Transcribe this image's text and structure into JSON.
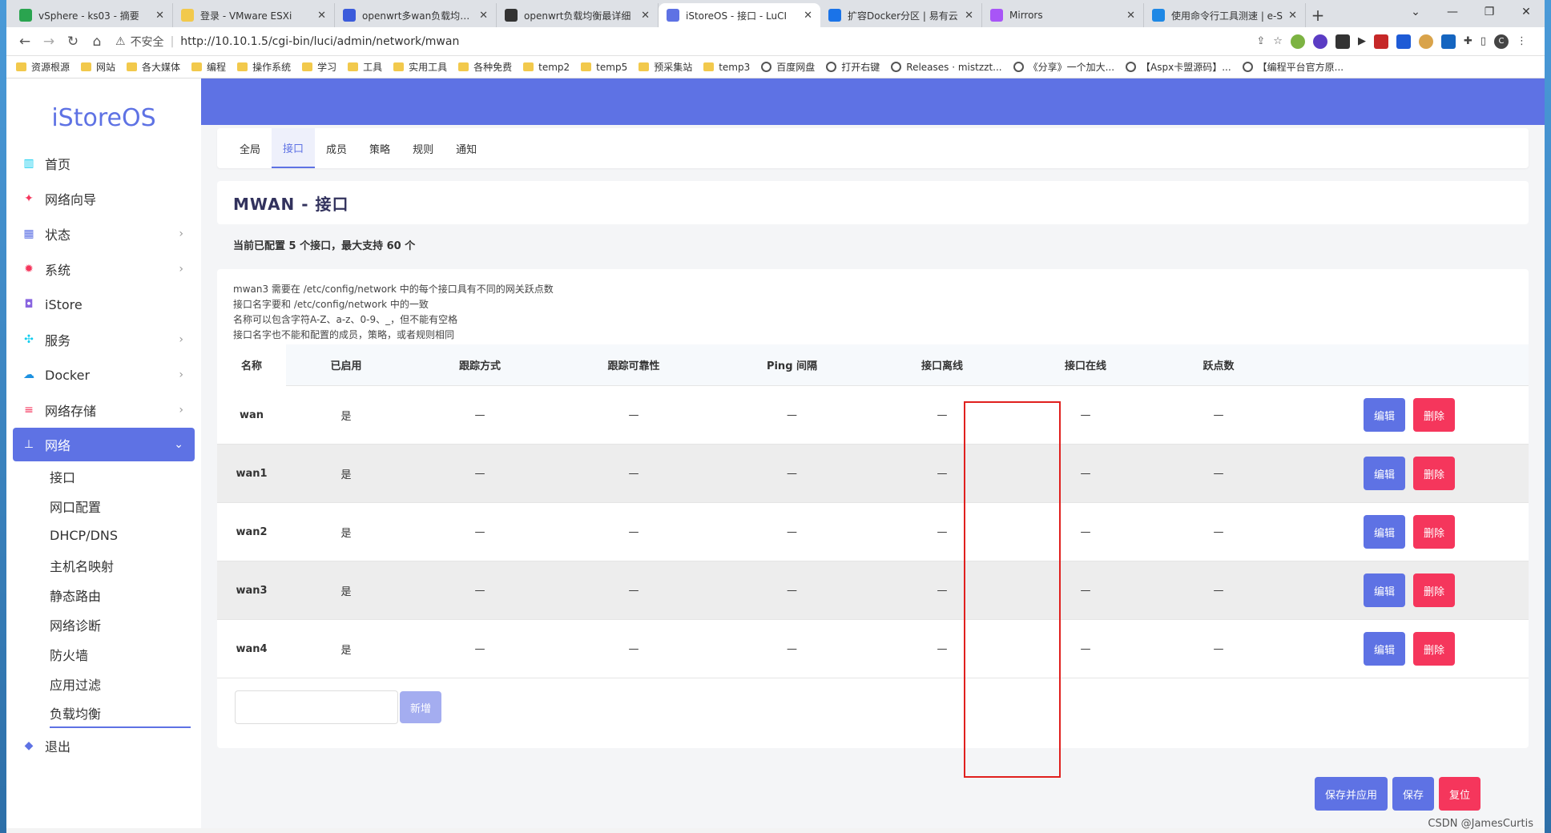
{
  "browser": {
    "tabs": [
      {
        "label": "vSphere - ks03 - 摘要",
        "color": "#2aa44f",
        "active": false
      },
      {
        "label": "登录 - VMware ESXi",
        "color": "#f2c94c",
        "active": false
      },
      {
        "label": "openwrt多wan负载均衡_",
        "color": "#3b5bdb",
        "active": false
      },
      {
        "label": "openwrt负载均衡最详细",
        "color": "#333333",
        "active": false
      },
      {
        "label": "iStoreOS - 接口 - LuCI",
        "color": "#5e72e4",
        "active": true
      },
      {
        "label": "扩容Docker分区 | 易有云",
        "color": "#1a73e8",
        "active": false
      },
      {
        "label": "Mirrors",
        "color": "#a855f7",
        "active": false
      },
      {
        "label": "使用命令行工具测速 | e-S",
        "color": "#1e88e5",
        "active": false
      }
    ],
    "new_tab": "+",
    "address": {
      "warning": "不安全",
      "url": "http://10.10.1.5/cgi-bin/luci/admin/network/mwan"
    },
    "bookmarks": [
      {
        "label": "资源根源",
        "type": "folder"
      },
      {
        "label": "网站",
        "type": "folder"
      },
      {
        "label": "各大媒体",
        "type": "folder"
      },
      {
        "label": "编程",
        "type": "folder"
      },
      {
        "label": "操作系统",
        "type": "folder"
      },
      {
        "label": "学习",
        "type": "folder"
      },
      {
        "label": "工具",
        "type": "folder"
      },
      {
        "label": "实用工具",
        "type": "folder"
      },
      {
        "label": "各种免费",
        "type": "folder"
      },
      {
        "label": "temp2",
        "type": "folder"
      },
      {
        "label": "temp5",
        "type": "folder"
      },
      {
        "label": "预采集站",
        "type": "folder"
      },
      {
        "label": "temp3",
        "type": "folder"
      },
      {
        "label": "百度网盘",
        "type": "globe"
      },
      {
        "label": "打开右键",
        "type": "globe"
      },
      {
        "label": "Releases · mistzzt...",
        "type": "globe"
      },
      {
        "label": "《分享》一个加大...",
        "type": "globe"
      },
      {
        "label": "【Aspx卡盟源码】...",
        "type": "globe"
      },
      {
        "label": "【编程平台官方原...",
        "type": "globe"
      }
    ]
  },
  "sidebar": {
    "logo": "iStoreOS",
    "items": [
      {
        "label": "首页",
        "icon": "dashboard-icon",
        "color": "#11cdef",
        "chevron": false
      },
      {
        "label": "网络向导",
        "icon": "rocket-icon",
        "color": "#f5365c",
        "chevron": false
      },
      {
        "label": "状态",
        "icon": "grid-icon",
        "color": "#5e72e4",
        "chevron": true
      },
      {
        "label": "系统",
        "icon": "gear-icon",
        "color": "#f5365c",
        "chevron": true
      },
      {
        "label": "iStore",
        "icon": "store-icon",
        "color": "#8965e0",
        "chevron": false
      },
      {
        "label": "服务",
        "icon": "puzzle-icon",
        "color": "#11cdef",
        "chevron": true
      },
      {
        "label": "Docker",
        "icon": "docker-icon",
        "color": "#1d91e0",
        "chevron": true
      },
      {
        "label": "网络存储",
        "icon": "database-icon",
        "color": "#f5365c",
        "chevron": true
      }
    ],
    "active": {
      "label": "网络",
      "icon": "network-icon"
    },
    "sub_items": [
      "接口",
      "网口配置",
      "DHCP/DNS",
      "主机名映射",
      "静态路由",
      "网络诊断",
      "防火墙",
      "应用过滤",
      "负载均衡"
    ],
    "logout": {
      "label": "退出",
      "icon": "cube-icon"
    }
  },
  "page": {
    "tabs": [
      "全局",
      "接口",
      "成员",
      "策略",
      "规则",
      "通知"
    ],
    "active_tab": "接口",
    "title": "MWAN - 接口",
    "count_text": "当前已配置 5 个接口，最大支持 60 个",
    "notes": [
      "mwan3 需要在 /etc/config/network 中的每个接口具有不同的网关跃点数",
      "接口名字要和 /etc/config/network 中的一致",
      "名称可以包含字符A-Z、a-z、0-9、_，但不能有空格",
      "接口名字也不能和配置的成员，策略，或者规则相同"
    ],
    "columns": [
      "名称",
      "已启用",
      "跟踪方式",
      "跟踪可靠性",
      "Ping 间隔",
      "接口离线",
      "接口在线",
      "跃点数"
    ],
    "rows": [
      {
        "name": "wan",
        "enabled": "是",
        "track_method": "—",
        "reliability": "—",
        "ping": "—",
        "down": "—",
        "up": "—",
        "metric": "—"
      },
      {
        "name": "wan1",
        "enabled": "是",
        "track_method": "—",
        "reliability": "—",
        "ping": "—",
        "down": "—",
        "up": "—",
        "metric": "—"
      },
      {
        "name": "wan2",
        "enabled": "是",
        "track_method": "—",
        "reliability": "—",
        "ping": "—",
        "down": "—",
        "up": "—",
        "metric": "—"
      },
      {
        "name": "wan3",
        "enabled": "是",
        "track_method": "—",
        "reliability": "—",
        "ping": "—",
        "down": "—",
        "up": "—",
        "metric": "—"
      },
      {
        "name": "wan4",
        "enabled": "是",
        "track_method": "—",
        "reliability": "—",
        "ping": "—",
        "down": "—",
        "up": "—",
        "metric": "—"
      }
    ],
    "edit_label": "编辑",
    "delete_label": "删除",
    "add_input_value": "",
    "add_label": "新增",
    "save_apply_label": "保存并应用",
    "save_label": "保存",
    "reset_label": "复位"
  },
  "watermark": "CSDN @JamesCurtis"
}
